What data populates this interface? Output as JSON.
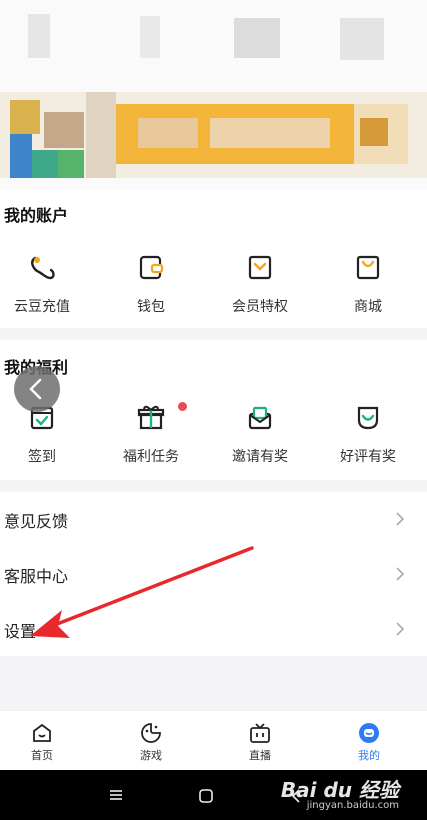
{
  "account": {
    "title": "我的账户",
    "items": [
      {
        "label": "云豆充值",
        "icon": "bean-icon"
      },
      {
        "label": "钱包",
        "icon": "wallet-icon"
      },
      {
        "label": "会员特权",
        "icon": "vip-icon"
      },
      {
        "label": "商城",
        "icon": "shop-bag-icon"
      }
    ]
  },
  "welfare": {
    "title": "我的福利",
    "items": [
      {
        "label": "签到",
        "icon": "calendar-check-icon"
      },
      {
        "label": "福利任务",
        "icon": "gift-icon",
        "badge_dot": true
      },
      {
        "label": "邀请有奖",
        "icon": "invite-envelope-icon"
      },
      {
        "label": "好评有奖",
        "icon": "smile-icon"
      }
    ]
  },
  "menu_rows": [
    {
      "label": "意见反馈"
    },
    {
      "label": "客服中心"
    },
    {
      "label": "设置"
    }
  ],
  "tabs": [
    {
      "label": "首页",
      "icon": "home-icon",
      "active": false
    },
    {
      "label": "游戏",
      "icon": "game-icon",
      "active": false
    },
    {
      "label": "直播",
      "icon": "tv-icon",
      "active": false
    },
    {
      "label": "我的",
      "icon": "me-icon",
      "active": true
    }
  ],
  "watermark": {
    "main": "Bai du 经验",
    "sub": "jingyan.baidu.com"
  },
  "colors": {
    "accent_green": "#20b27a",
    "accent_orange": "#f4a51c",
    "active_tab_blue": "#2d7cf6",
    "annotation_arrow": "#e8282b",
    "badge_red": "#e84a5a"
  }
}
